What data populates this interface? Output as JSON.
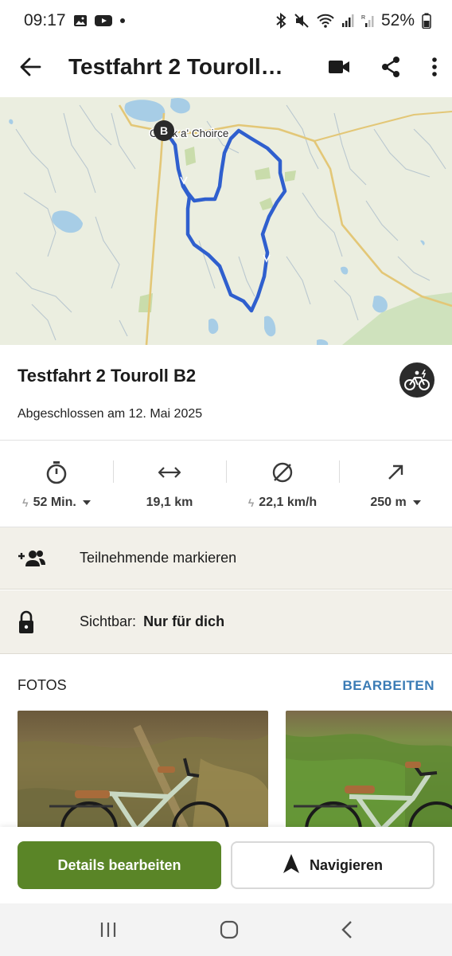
{
  "status_bar": {
    "time": "09:17",
    "battery": "52%",
    "icons": [
      "gallery-icon",
      "youtube-icon",
      "dot-icon",
      "bluetooth-icon",
      "mute-icon",
      "wifi-icon",
      "signal-icon",
      "signal-roaming-icon",
      "battery-icon"
    ]
  },
  "app_bar": {
    "title": "Testfahrt 2 Touroll…",
    "icons": [
      "back-arrow-icon",
      "video-icon",
      "share-icon",
      "more-vert-icon"
    ]
  },
  "map": {
    "place_label": "Crask a' Choirce",
    "marker_label": "B",
    "route_color": "#2f5fce"
  },
  "tour": {
    "name": "Testfahrt 2 Touroll B2",
    "completed": "Abgeschlossen am 12. Mai 2025",
    "sport_icon": "e-bike-icon"
  },
  "stats": [
    {
      "icon": "stopwatch-icon",
      "value": "52 Min.",
      "bolt": true,
      "dropdown": true
    },
    {
      "icon": "distance-icon",
      "value": "19,1 km",
      "bolt": false,
      "dropdown": false
    },
    {
      "icon": "average-speed-icon",
      "value": "22,1 km/h",
      "bolt": true,
      "dropdown": false
    },
    {
      "icon": "elevation-icon",
      "value": "250 m",
      "bolt": false,
      "dropdown": true
    }
  ],
  "participants": {
    "label": "Teilnehmende markieren"
  },
  "visibility": {
    "label": "Sichtbar:",
    "value": "Nur für dich"
  },
  "photos": {
    "title": "FOTOS",
    "edit": "BEARBEITEN"
  },
  "actions": {
    "primary": "Details bearbeiten",
    "secondary": "Navigieren"
  },
  "colors": {
    "primary_green": "#5a8527",
    "link_blue": "#3a7bb5",
    "route_blue": "#2f5fce"
  }
}
